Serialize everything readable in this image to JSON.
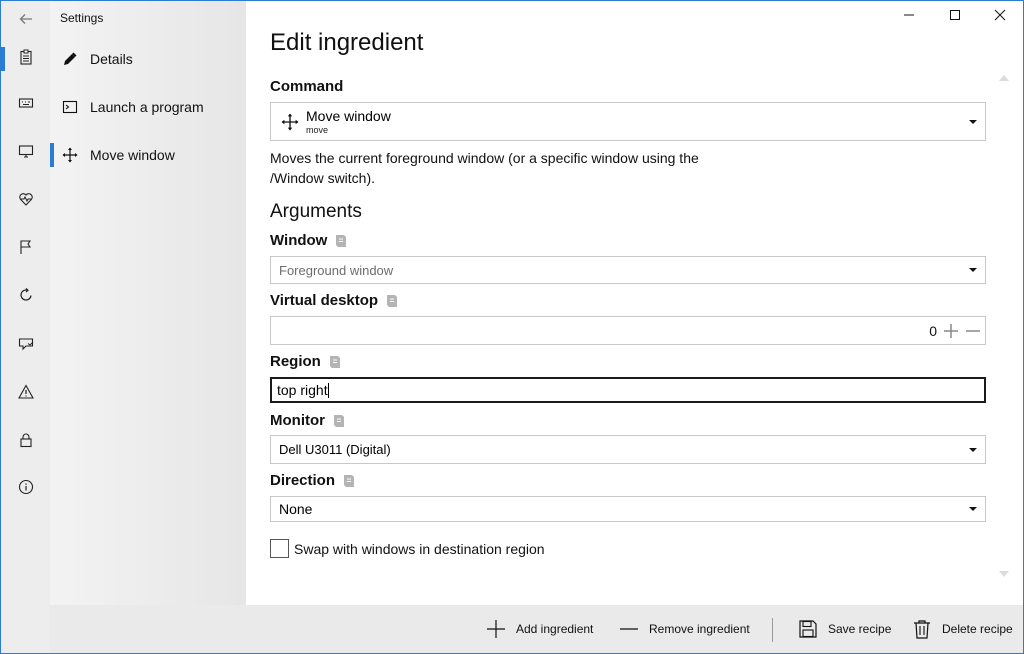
{
  "window": {
    "app_title": "Settings"
  },
  "rail": {
    "items": [
      {
        "icon": "back-arrow-icon"
      },
      {
        "icon": "clipboard-icon"
      },
      {
        "icon": "keyboard-icon"
      },
      {
        "icon": "monitor-icon"
      },
      {
        "icon": "heart-pulse-icon"
      },
      {
        "icon": "flag-icon"
      },
      {
        "icon": "refresh-icon"
      },
      {
        "icon": "shield-chat-icon"
      },
      {
        "icon": "warning-icon"
      },
      {
        "icon": "lock-icon"
      },
      {
        "icon": "info-icon"
      }
    ]
  },
  "nav": {
    "items": [
      {
        "label": "Details",
        "icon": "pen-icon"
      },
      {
        "label": "Launch a program",
        "icon": "terminal-icon"
      },
      {
        "label": "Move window",
        "icon": "move-icon"
      }
    ]
  },
  "page": {
    "title": "Edit ingredient",
    "command_label": "Command",
    "command_value": "Move window",
    "command_sub": "move",
    "description": "Moves the current foreground window (or a specific window using the /Window switch).",
    "arguments_title": "Arguments",
    "window_label": "Window",
    "window_placeholder": "Foreground window",
    "virtual_desktop_label": "Virtual desktop",
    "virtual_desktop_value": "0",
    "region_label": "Region",
    "region_value": "top right",
    "monitor_label": "Monitor",
    "monitor_value": "Dell U3011 (Digital)",
    "direction_label": "Direction",
    "direction_value": "None",
    "swap_label": "Swap with windows in destination region"
  },
  "commandbar": {
    "add": "Add ingredient",
    "remove": "Remove ingredient",
    "save": "Save recipe",
    "delete": "Delete recipe"
  },
  "colors": {
    "accent": "#2b7cd3"
  }
}
